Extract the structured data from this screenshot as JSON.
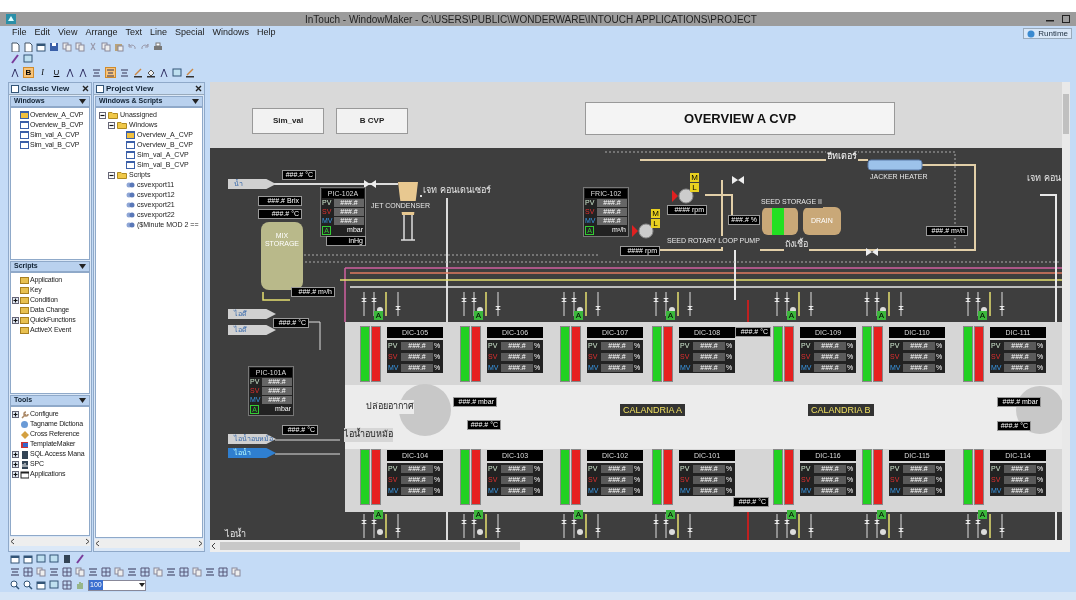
{
  "window": {
    "title": "InTouch - WindowMaker - C:\\USERS\\PUBLIC\\WONDERWARE\\INTOUCH APPLICATIONS\\PROJECT"
  },
  "menu": [
    "File",
    "Edit",
    "View",
    "Arrange",
    "Text",
    "Line",
    "Special",
    "Windows",
    "Help"
  ],
  "runtime_button": {
    "label": "Runtime"
  },
  "format_buttons": [
    {
      "label": "B",
      "selected": true
    },
    {
      "label": "I",
      "selected": false
    },
    {
      "label": "U",
      "selected": false
    }
  ],
  "align_buttons": [
    {
      "selected": false
    },
    {
      "selected": true
    },
    {
      "selected": false
    }
  ],
  "classic_view": {
    "title": "Classic View",
    "sections": [
      {
        "title": "Windows",
        "items": [
          {
            "label": "Overview_A_CVP",
            "open": true
          },
          {
            "label": "Overview_B_CVP",
            "open": false
          },
          {
            "label": "Sim_val_A_CVP",
            "open": false
          },
          {
            "label": "Sim_val_B_CVP",
            "open": false
          }
        ]
      },
      {
        "title": "Scripts",
        "items": [
          {
            "label": "Application",
            "has_children": false
          },
          {
            "label": "Key",
            "has_children": false
          },
          {
            "label": "Condition",
            "has_children": true
          },
          {
            "label": "Data Change",
            "has_children": false
          },
          {
            "label": "QuickFunctions",
            "has_children": true
          },
          {
            "label": "ActiveX Event",
            "has_children": false
          }
        ]
      },
      {
        "title": "Tools",
        "items": [
          {
            "label": "Configure",
            "has_children": true
          },
          {
            "label": "Tagname Dictiona",
            "has_children": false
          },
          {
            "label": "Cross Reference",
            "has_children": false
          },
          {
            "label": "TemplateMaker",
            "has_children": false
          },
          {
            "label": "SQL Access Mana",
            "has_children": true
          },
          {
            "label": "SPC",
            "has_children": true
          },
          {
            "label": "Applications",
            "has_children": true
          }
        ]
      }
    ]
  },
  "project_view": {
    "title": "Project View",
    "section": "Windows & Scripts",
    "tree": [
      {
        "kind": "folder",
        "label": "Unassigned",
        "expanded": true,
        "children": [
          {
            "kind": "folder",
            "label": "Windows",
            "expanded": true,
            "children": [
              {
                "kind": "window",
                "label": "Overview_A_CVP",
                "open": true
              },
              {
                "kind": "window",
                "label": "Overview_B_CVP",
                "open": false
              },
              {
                "kind": "window",
                "label": "Sim_val_A_CVP",
                "open": false
              },
              {
                "kind": "window",
                "label": "Sim_val_B_CVP",
                "open": false
              }
            ]
          },
          {
            "kind": "folder",
            "label": "Scripts",
            "expanded": true,
            "children": [
              {
                "kind": "script",
                "label": "csvexport11"
              },
              {
                "kind": "script",
                "label": "csvexport12"
              },
              {
                "kind": "script",
                "label": "csvexport21"
              },
              {
                "kind": "script",
                "label": "csvexport22"
              },
              {
                "kind": "script",
                "label": "($Minute MOD 2 =="
              }
            ]
          }
        ]
      }
    ]
  },
  "canvas": {
    "buttons": [
      "Sim_val",
      "B CVP"
    ],
    "title": "OVERVIEW A CVP",
    "inlet_arrows": [
      {
        "label": "น้ำ",
        "selected": false
      },
      {
        "label": "ไอดี",
        "selected": false
      },
      {
        "label": "ไอดี",
        "selected": false
      },
      {
        "label": "ไอน้ำอบหม้อ",
        "selected": false
      },
      {
        "label": "ไอน้ำ",
        "selected": true
      }
    ],
    "controllers": [
      {
        "tag": "PIC-102A",
        "rows": [
          {
            "label": "PV",
            "value": "###.#"
          },
          {
            "label": "SV",
            "value": "###.#"
          },
          {
            "label": "MV",
            "value": "###.#"
          }
        ],
        "mode": "A",
        "unit": "mbar"
      },
      {
        "tag": "FRIC-102",
        "rows": [
          {
            "label": "PV",
            "value": "###.#"
          },
          {
            "label": "SV",
            "value": "###.#"
          },
          {
            "label": "MV",
            "value": "###.#"
          }
        ],
        "mode": "A",
        "unit": "m³/h"
      },
      {
        "tag": "PIC-101A",
        "rows": [
          {
            "label": "PV",
            "value": "###.#"
          },
          {
            "label": "SV",
            "value": "###.#"
          },
          {
            "label": "MV",
            "value": "###.#"
          }
        ],
        "mode": "A",
        "unit": "mbar"
      }
    ],
    "displays": [
      "###.# °C",
      "###.# Brix",
      "###.# °C",
      "###.# m³/h",
      "#### rpm",
      "#### rpm",
      "###.# %",
      "###.# m³/h",
      "###.# °C",
      "###.# °C",
      "###.# °C",
      "###.# mbar",
      "###.# °C",
      "###.# mbar",
      "###.# °C",
      "###.# °C",
      "inHg"
    ],
    "labels": [
      "เจท คอนเดนเซอร์",
      "JET CONDENSER",
      "MIX STORAGE",
      "SEED ROTARY LOOP PUMP",
      "JACKER HEATER",
      "ฮีทเตอร์",
      "SEED STORAGE II",
      "DRAIN",
      "ถังเชื้อ",
      "ปล่อยอากาศ",
      "ไอน้ำอบหม้อ",
      "ไอน้ำ",
      "เจท คอน"
    ],
    "pumps": [
      {
        "tags": [
          "M",
          "L"
        ]
      },
      {
        "tags": [
          "M",
          "L"
        ]
      }
    ],
    "calandria_labels": [
      "CALANDRIA A",
      "CALANDRIA B"
    ],
    "dic_controllers": [
      {
        "tag": "DIC-105",
        "bars": [
          {
            "color": "#22d022",
            "level": 1
          },
          {
            "color": "#e62020",
            "level": 1
          }
        ],
        "rows": [
          {
            "label": "PV",
            "value": "###.#",
            "unit": "%"
          },
          {
            "label": "SV",
            "value": "###.#",
            "unit": "%"
          },
          {
            "label": "MV",
            "value": "###.#",
            "unit": "%"
          }
        ]
      },
      {
        "tag": "DIC-106",
        "bars": [
          {
            "color": "#22d022",
            "level": 1
          },
          {
            "color": "#e62020",
            "level": 1
          }
        ],
        "rows": [
          {
            "label": "PV",
            "value": "###.#",
            "unit": "%"
          },
          {
            "label": "SV",
            "value": "###.#",
            "unit": "%"
          },
          {
            "label": "MV",
            "value": "###.#",
            "unit": "%"
          }
        ]
      },
      {
        "tag": "DIC-107",
        "bars": [
          {
            "color": "#22d022",
            "level": 1
          },
          {
            "color": "#e62020",
            "level": 1
          }
        ],
        "rows": [
          {
            "label": "PV",
            "value": "###.#",
            "unit": "%"
          },
          {
            "label": "SV",
            "value": "###.#",
            "unit": "%"
          },
          {
            "label": "MV",
            "value": "###.#",
            "unit": "%"
          }
        ]
      },
      {
        "tag": "DIC-108",
        "bars": [
          {
            "color": "#22d022",
            "level": 1
          },
          {
            "color": "#e62020",
            "level": 1
          }
        ],
        "rows": [
          {
            "label": "PV",
            "value": "###.#",
            "unit": "%"
          },
          {
            "label": "SV",
            "value": "###.#",
            "unit": "%"
          },
          {
            "label": "MV",
            "value": "###.#",
            "unit": "%"
          }
        ]
      },
      {
        "tag": "DIC-109",
        "bars": [
          {
            "color": "#22d022",
            "level": 1
          },
          {
            "color": "#e62020",
            "level": 1
          }
        ],
        "rows": [
          {
            "label": "PV",
            "value": "###.#",
            "unit": "%"
          },
          {
            "label": "SV",
            "value": "###.#",
            "unit": "%"
          },
          {
            "label": "MV",
            "value": "###.#",
            "unit": "%"
          }
        ]
      },
      {
        "tag": "DIC-110",
        "bars": [
          {
            "color": "#22d022",
            "level": 1
          },
          {
            "color": "#e62020",
            "level": 1
          }
        ],
        "rows": [
          {
            "label": "PV",
            "value": "###.#",
            "unit": "%"
          },
          {
            "label": "SV",
            "value": "###.#",
            "unit": "%"
          },
          {
            "label": "MV",
            "value": "###.#",
            "unit": "%"
          }
        ]
      },
      {
        "tag": "DIC-111",
        "bars": [
          {
            "color": "#22d022",
            "level": 1
          },
          {
            "color": "#e62020",
            "level": 1
          }
        ],
        "rows": [
          {
            "label": "PV",
            "value": "###.#",
            "unit": "%"
          },
          {
            "label": "SV",
            "value": "###.#",
            "unit": "%"
          },
          {
            "label": "MV",
            "value": "###.#",
            "unit": "%"
          }
        ]
      },
      {
        "tag": "DIC-104",
        "bars": [
          {
            "color": "#22d022",
            "level": 1
          },
          {
            "color": "#e62020",
            "level": 1
          }
        ],
        "rows": [
          {
            "label": "PV",
            "value": "###.#",
            "unit": "%"
          },
          {
            "label": "SV",
            "value": "###.#",
            "unit": "%"
          },
          {
            "label": "MV",
            "value": "###.#",
            "unit": "%"
          }
        ]
      },
      {
        "tag": "DIC-103",
        "bars": [
          {
            "color": "#22d022",
            "level": 1
          },
          {
            "color": "#e62020",
            "level": 1
          }
        ],
        "rows": [
          {
            "label": "PV",
            "value": "###.#",
            "unit": "%"
          },
          {
            "label": "SV",
            "value": "###.#",
            "unit": "%"
          },
          {
            "label": "MV",
            "value": "###.#",
            "unit": "%"
          }
        ]
      },
      {
        "tag": "DIC-102",
        "bars": [
          {
            "color": "#22d022",
            "level": 1
          },
          {
            "color": "#e62020",
            "level": 1
          }
        ],
        "rows": [
          {
            "label": "PV",
            "value": "###.#",
            "unit": "%"
          },
          {
            "label": "SV",
            "value": "###.#",
            "unit": "%"
          },
          {
            "label": "MV",
            "value": "###.#",
            "unit": "%"
          }
        ]
      },
      {
        "tag": "DIC-101",
        "bars": [
          {
            "color": "#22d022",
            "level": 1
          },
          {
            "color": "#e62020",
            "level": 1
          }
        ],
        "rows": [
          {
            "label": "PV",
            "value": "###.#",
            "unit": "%"
          },
          {
            "label": "SV",
            "value": "###.#",
            "unit": "%"
          },
          {
            "label": "MV",
            "value": "###.#",
            "unit": "%"
          }
        ]
      },
      {
        "tag": "DIC-116",
        "bars": [
          {
            "color": "#22d022",
            "level": 1
          },
          {
            "color": "#e62020",
            "level": 1
          }
        ],
        "rows": [
          {
            "label": "PV",
            "value": "###.#",
            "unit": "%"
          },
          {
            "label": "SV",
            "value": "###.#",
            "unit": "%"
          },
          {
            "label": "MV",
            "value": "###.#",
            "unit": "%"
          }
        ]
      },
      {
        "tag": "DIC-115",
        "bars": [
          {
            "color": "#22d022",
            "level": 1
          },
          {
            "color": "#e62020",
            "level": 1
          }
        ],
        "rows": [
          {
            "label": "PV",
            "value": "###.#",
            "unit": "%"
          },
          {
            "label": "SV",
            "value": "###.#",
            "unit": "%"
          },
          {
            "label": "MV",
            "value": "###.#",
            "unit": "%"
          }
        ]
      },
      {
        "tag": "DIC-114",
        "bars": [
          {
            "color": "#22d022",
            "level": 1
          },
          {
            "color": "#e62020",
            "level": 1
          }
        ],
        "rows": [
          {
            "label": "PV",
            "value": "###.#",
            "unit": "%"
          },
          {
            "label": "SV",
            "value": "###.#",
            "unit": "%"
          },
          {
            "label": "MV",
            "value": "###.#",
            "unit": "%"
          }
        ]
      }
    ],
    "valve_stations": [
      {
        "tag": "A"
      },
      {
        "tag": "A"
      },
      {
        "tag": "A"
      },
      {
        "tag": "A"
      },
      {
        "tag": "A"
      },
      {
        "tag": "A"
      },
      {
        "tag": "A"
      },
      {
        "tag": "A"
      },
      {
        "tag": "A"
      },
      {
        "tag": "A"
      },
      {
        "tag": "A"
      },
      {
        "tag": "A"
      },
      {
        "tag": "A"
      },
      {
        "tag": "A"
      }
    ]
  },
  "bottom_toolbar": {
    "zoom": "100"
  }
}
